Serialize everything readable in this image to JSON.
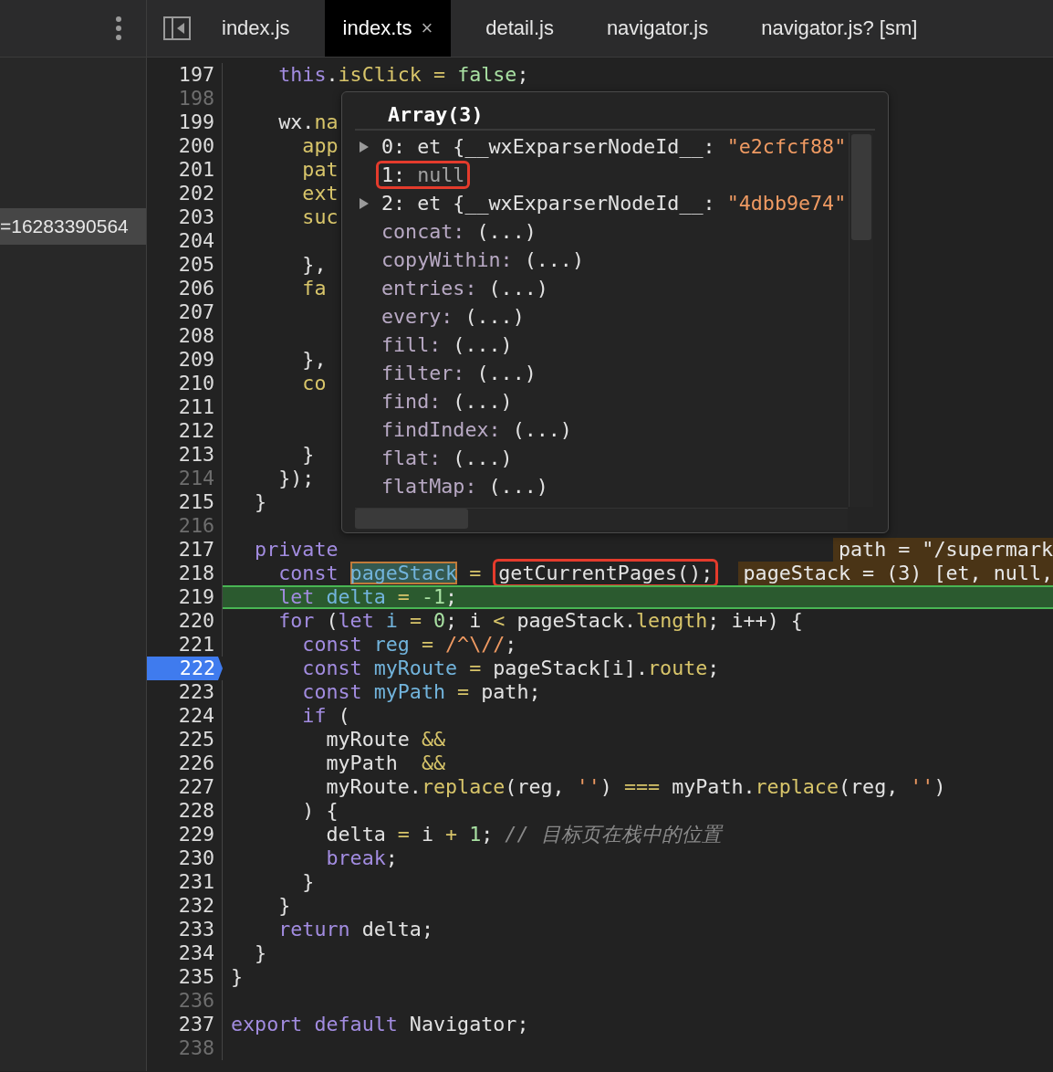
{
  "tabs": [
    {
      "label": "index.js",
      "selected": false,
      "closable": false
    },
    {
      "label": "index.ts",
      "selected": true,
      "closable": true,
      "close": "×"
    },
    {
      "label": "detail.js",
      "selected": false,
      "closable": false
    },
    {
      "label": "navigator.js",
      "selected": false,
      "closable": false
    },
    {
      "label": "navigator.js? [sm]",
      "selected": false,
      "closable": false
    }
  ],
  "side_panel": {
    "selected_row": "=16283390564"
  },
  "lines": [
    {
      "num": "197",
      "dim": false,
      "breakpoint": false,
      "current": false,
      "tokens": [
        {
          "kind": "kw",
          "text": "    this"
        },
        {
          "kind": "plain",
          "text": "."
        },
        {
          "kind": "prop",
          "text": "isClick "
        },
        {
          "kind": "op",
          "text": "= "
        },
        {
          "kind": "num",
          "text": "false"
        },
        {
          "kind": "plain",
          "text": ";"
        }
      ]
    },
    {
      "num": "198",
      "dim": true,
      "breakpoint": false,
      "current": false
    },
    {
      "num": "199",
      "dim": false,
      "breakpoint": false,
      "current": false,
      "tokens": [
        {
          "kind": "plain",
          "text": "    wx."
        },
        {
          "kind": "prop",
          "text": "na"
        }
      ]
    },
    {
      "num": "200",
      "dim": false,
      "breakpoint": false,
      "current": false,
      "tokens": [
        {
          "kind": "prop",
          "text": "      app"
        }
      ]
    },
    {
      "num": "201",
      "dim": false,
      "breakpoint": false,
      "current": false,
      "tokens": [
        {
          "kind": "prop",
          "text": "      pat"
        }
      ]
    },
    {
      "num": "202",
      "dim": false,
      "breakpoint": false,
      "current": false,
      "tokens": [
        {
          "kind": "prop",
          "text": "      ext"
        }
      ]
    },
    {
      "num": "203",
      "dim": false,
      "breakpoint": false,
      "current": false,
      "tokens": [
        {
          "kind": "prop",
          "text": "      suc"
        }
      ]
    },
    {
      "num": "204",
      "dim": false,
      "breakpoint": false,
      "current": false
    },
    {
      "num": "205",
      "dim": false,
      "breakpoint": false,
      "current": false,
      "tokens": [
        {
          "kind": "plain",
          "text": "      },"
        }
      ]
    },
    {
      "num": "206",
      "dim": false,
      "breakpoint": false,
      "current": false,
      "tokens": [
        {
          "kind": "prop",
          "text": "      fa"
        }
      ]
    },
    {
      "num": "207",
      "dim": false,
      "breakpoint": false,
      "current": false
    },
    {
      "num": "208",
      "dim": false,
      "breakpoint": false,
      "current": false
    },
    {
      "num": "209",
      "dim": false,
      "breakpoint": false,
      "current": false,
      "tokens": [
        {
          "kind": "plain",
          "text": "      },"
        }
      ]
    },
    {
      "num": "210",
      "dim": false,
      "breakpoint": false,
      "current": false,
      "tokens": [
        {
          "kind": "prop",
          "text": "      co"
        }
      ]
    },
    {
      "num": "211",
      "dim": false,
      "breakpoint": false,
      "current": false
    },
    {
      "num": "212",
      "dim": false,
      "breakpoint": false,
      "current": false
    },
    {
      "num": "213",
      "dim": false,
      "breakpoint": false,
      "current": false,
      "tokens": [
        {
          "kind": "plain",
          "text": "      }"
        }
      ]
    },
    {
      "num": "214",
      "dim": true,
      "breakpoint": false,
      "current": false,
      "tokens": [
        {
          "kind": "plain",
          "text": "    });"
        }
      ]
    },
    {
      "num": "215",
      "dim": false,
      "breakpoint": false,
      "current": false,
      "tokens": [
        {
          "kind": "plain",
          "text": "  }"
        }
      ]
    },
    {
      "num": "216",
      "dim": true,
      "breakpoint": false,
      "current": false
    },
    {
      "num": "217",
      "dim": false,
      "breakpoint": false,
      "current": false,
      "tokens": [
        {
          "kind": "kw",
          "text": "  private"
        }
      ],
      "inline": "path = \"/supermark"
    },
    {
      "num": "218",
      "dim": false,
      "breakpoint": false,
      "current": false,
      "tokens": [
        {
          "kind": "kw",
          "text": "    const "
        },
        {
          "kind": "var",
          "text": "pageStack",
          "hover": true,
          "annotated": false
        },
        {
          "kind": "op",
          "text": " = "
        },
        {
          "kind": "plain",
          "text": "getCurrentPages();",
          "hover": false,
          "annotated": true
        }
      ],
      "inline": "pageStack = (3) [et, null,"
    },
    {
      "num": "219",
      "dim": false,
      "breakpoint": false,
      "current": true,
      "tokens": [
        {
          "kind": "kw",
          "text": "    let "
        },
        {
          "kind": "var",
          "text": "delta "
        },
        {
          "kind": "op",
          "text": "= "
        },
        {
          "kind": "num",
          "text": "-1"
        },
        {
          "kind": "plain",
          "text": ";"
        }
      ]
    },
    {
      "num": "220",
      "dim": false,
      "breakpoint": false,
      "current": false,
      "tokens": [
        {
          "kind": "kw",
          "text": "    for"
        },
        {
          "kind": "plain",
          "text": " ("
        },
        {
          "kind": "kw",
          "text": "let "
        },
        {
          "kind": "var",
          "text": "i "
        },
        {
          "kind": "op",
          "text": "= "
        },
        {
          "kind": "num",
          "text": "0"
        },
        {
          "kind": "plain",
          "text": "; i "
        },
        {
          "kind": "op",
          "text": "<"
        },
        {
          "kind": "plain",
          "text": " pageStack."
        },
        {
          "kind": "prop",
          "text": "length"
        },
        {
          "kind": "plain",
          "text": "; i++) {"
        }
      ]
    },
    {
      "num": "221",
      "dim": false,
      "breakpoint": false,
      "current": false,
      "tokens": [
        {
          "kind": "kw",
          "text": "      const "
        },
        {
          "kind": "var",
          "text": "reg "
        },
        {
          "kind": "op",
          "text": "= "
        },
        {
          "kind": "str",
          "text": "/^\\//"
        },
        {
          "kind": "plain",
          "text": ";"
        }
      ]
    },
    {
      "num": "222",
      "dim": false,
      "breakpoint": true,
      "current": false,
      "tokens": [
        {
          "kind": "kw",
          "text": "      const "
        },
        {
          "kind": "var",
          "text": "myRoute "
        },
        {
          "kind": "op",
          "text": "="
        },
        {
          "kind": "plain",
          "text": " pageStack[i]."
        },
        {
          "kind": "prop",
          "text": "route"
        },
        {
          "kind": "plain",
          "text": ";"
        }
      ]
    },
    {
      "num": "223",
      "dim": false,
      "breakpoint": false,
      "current": false,
      "tokens": [
        {
          "kind": "kw",
          "text": "      const "
        },
        {
          "kind": "var",
          "text": "myPath "
        },
        {
          "kind": "op",
          "text": "="
        },
        {
          "kind": "plain",
          "text": " path;"
        }
      ]
    },
    {
      "num": "224",
      "dim": false,
      "breakpoint": false,
      "current": false,
      "tokens": [
        {
          "kind": "kw",
          "text": "      if"
        },
        {
          "kind": "plain",
          "text": " ("
        }
      ]
    },
    {
      "num": "225",
      "dim": false,
      "breakpoint": false,
      "current": false,
      "tokens": [
        {
          "kind": "plain",
          "text": "        myRoute "
        },
        {
          "kind": "op",
          "text": "&&"
        }
      ]
    },
    {
      "num": "226",
      "dim": false,
      "breakpoint": false,
      "current": false,
      "tokens": [
        {
          "kind": "plain",
          "text": "        myPath  "
        },
        {
          "kind": "op",
          "text": "&&"
        }
      ]
    },
    {
      "num": "227",
      "dim": false,
      "breakpoint": false,
      "current": false,
      "tokens": [
        {
          "kind": "plain",
          "text": "        myRoute."
        },
        {
          "kind": "prop",
          "text": "replace"
        },
        {
          "kind": "plain",
          "text": "(reg, "
        },
        {
          "kind": "str",
          "text": "''"
        },
        {
          "kind": "plain",
          "text": ") "
        },
        {
          "kind": "op",
          "text": "==="
        },
        {
          "kind": "plain",
          "text": " myPath."
        },
        {
          "kind": "prop",
          "text": "replace"
        },
        {
          "kind": "plain",
          "text": "(reg, "
        },
        {
          "kind": "str",
          "text": "''"
        },
        {
          "kind": "plain",
          "text": ")"
        }
      ]
    },
    {
      "num": "228",
      "dim": false,
      "breakpoint": false,
      "current": false,
      "tokens": [
        {
          "kind": "plain",
          "text": "      ) {"
        }
      ]
    },
    {
      "num": "229",
      "dim": false,
      "breakpoint": false,
      "current": false,
      "tokens": [
        {
          "kind": "plain",
          "text": "        delta "
        },
        {
          "kind": "op",
          "text": "="
        },
        {
          "kind": "plain",
          "text": " i "
        },
        {
          "kind": "op",
          "text": "+ "
        },
        {
          "kind": "num",
          "text": "1"
        },
        {
          "kind": "plain",
          "text": "; "
        },
        {
          "kind": "comment",
          "text": "// 目标页在栈中的位置"
        }
      ]
    },
    {
      "num": "230",
      "dim": false,
      "breakpoint": false,
      "current": false,
      "tokens": [
        {
          "kind": "kw",
          "text": "        break"
        },
        {
          "kind": "plain",
          "text": ";"
        }
      ]
    },
    {
      "num": "231",
      "dim": false,
      "breakpoint": false,
      "current": false,
      "tokens": [
        {
          "kind": "plain",
          "text": "      }"
        }
      ]
    },
    {
      "num": "232",
      "dim": false,
      "breakpoint": false,
      "current": false,
      "tokens": [
        {
          "kind": "plain",
          "text": "    }"
        }
      ]
    },
    {
      "num": "233",
      "dim": false,
      "breakpoint": false,
      "current": false,
      "tokens": [
        {
          "kind": "kw",
          "text": "    return"
        },
        {
          "kind": "plain",
          "text": " delta;"
        }
      ]
    },
    {
      "num": "234",
      "dim": false,
      "breakpoint": false,
      "current": false,
      "tokens": [
        {
          "kind": "plain",
          "text": "  }"
        }
      ]
    },
    {
      "num": "235",
      "dim": false,
      "breakpoint": false,
      "current": false,
      "tokens": [
        {
          "kind": "plain",
          "text": "}"
        }
      ]
    },
    {
      "num": "236",
      "dim": true,
      "breakpoint": false,
      "current": false
    },
    {
      "num": "237",
      "dim": false,
      "breakpoint": false,
      "current": false,
      "tokens": [
        {
          "kind": "kw",
          "text": "export default"
        },
        {
          "kind": "plain",
          "text": " Navigator;"
        }
      ]
    },
    {
      "num": "238",
      "dim": true,
      "breakpoint": false,
      "current": false
    }
  ],
  "popover": {
    "title": "Array(3)",
    "rows": [
      {
        "kind": "object",
        "key": "0: ",
        "value": "et {__wxExparserNodeId__: ",
        "string": "\"e2cfcf88\"",
        "expandable": true,
        "annotated": false
      },
      {
        "kind": "null",
        "key": "1: ",
        "value": "null",
        "expandable": false,
        "annotated": true
      },
      {
        "kind": "object",
        "key": "2: ",
        "value": "et {__wxExparserNodeId__: ",
        "string": "\"4dbb9e74\"",
        "expandable": true,
        "annotated": false
      },
      {
        "kind": "method",
        "key": "concat: ",
        "value": "(...)",
        "expandable": false,
        "annotated": false
      },
      {
        "kind": "method",
        "key": "copyWithin: ",
        "value": "(...)",
        "expandable": false,
        "annotated": false
      },
      {
        "kind": "method",
        "key": "entries: ",
        "value": "(...)",
        "expandable": false,
        "annotated": false
      },
      {
        "kind": "method",
        "key": "every: ",
        "value": "(...)",
        "expandable": false,
        "annotated": false
      },
      {
        "kind": "method",
        "key": "fill: ",
        "value": "(...)",
        "expandable": false,
        "annotated": false
      },
      {
        "kind": "method",
        "key": "filter: ",
        "value": "(...)",
        "expandable": false,
        "annotated": false
      },
      {
        "kind": "method",
        "key": "find: ",
        "value": "(...)",
        "expandable": false,
        "annotated": false
      },
      {
        "kind": "method",
        "key": "findIndex: ",
        "value": "(...)",
        "expandable": false,
        "annotated": false
      },
      {
        "kind": "method",
        "key": "flat: ",
        "value": "(...)",
        "expandable": false,
        "annotated": false
      },
      {
        "kind": "method",
        "key": "flatMap: ",
        "value": "(...)",
        "expandable": false,
        "annotated": false
      }
    ]
  }
}
